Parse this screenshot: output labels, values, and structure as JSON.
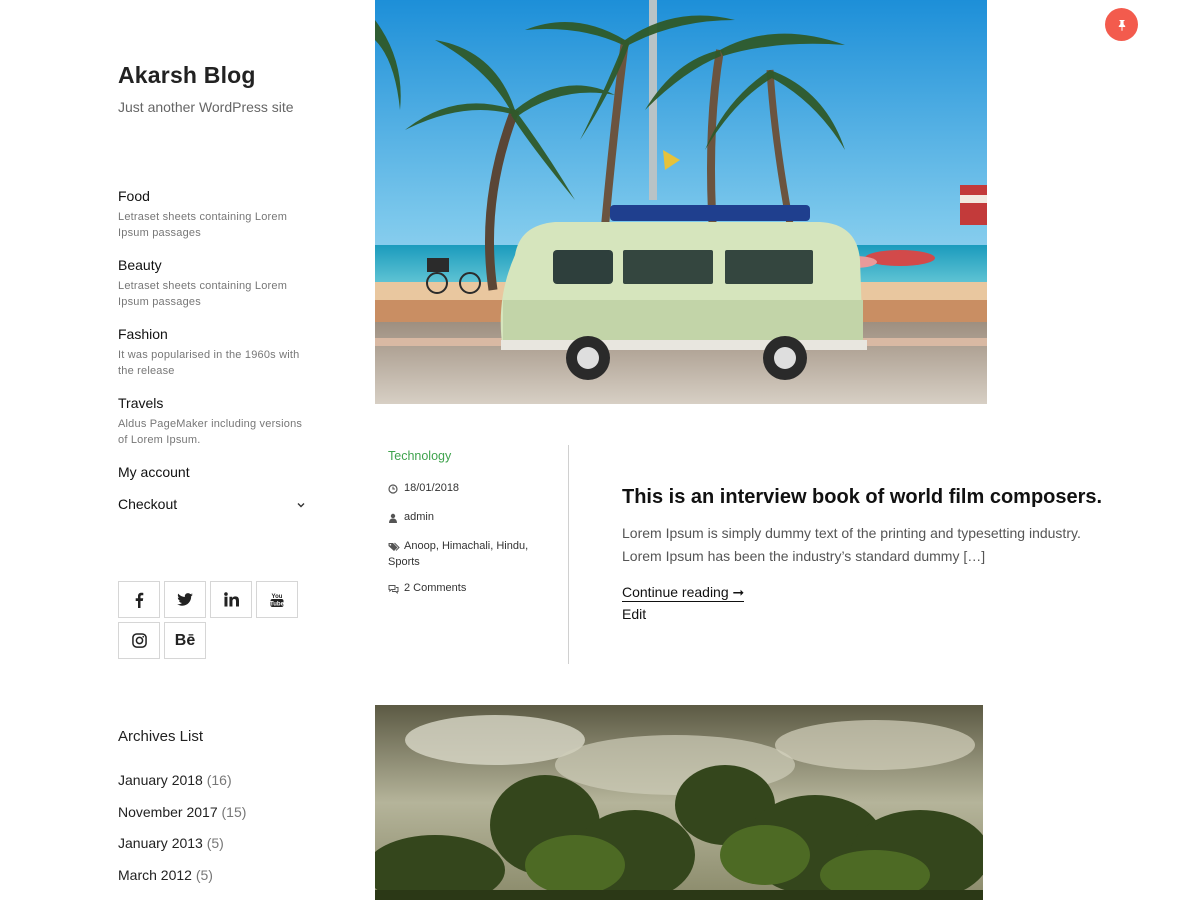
{
  "site": {
    "title": "Akarsh Blog",
    "tagline": "Just another WordPress site"
  },
  "menu": {
    "items": [
      {
        "label": "Food",
        "description": "Letraset sheets containing Lorem Ipsum passages"
      },
      {
        "label": "Beauty",
        "description": "Letraset sheets containing Lorem Ipsum passages"
      },
      {
        "label": "Fashion",
        "description": "It was popularised in the 1960s with the release"
      },
      {
        "label": "Travels",
        "description": "Aldus PageMaker including versions of Lorem Ipsum."
      },
      {
        "label": "My account"
      },
      {
        "label": "Checkout",
        "icon": "chevron-down-icon"
      }
    ]
  },
  "social": {
    "icons": [
      "facebook-icon",
      "twitter-icon",
      "linkedin-icon",
      "youtube-icon",
      "instagram-icon",
      "behance-icon"
    ],
    "behance_text": "Bē"
  },
  "archives": {
    "title": "Archives List",
    "items": [
      {
        "label": "January 2018",
        "count": "(16)"
      },
      {
        "label": "November 2017",
        "count": "(15)"
      },
      {
        "label": "January 2013",
        "count": "(5)"
      },
      {
        "label": "March 2012",
        "count": "(5)"
      }
    ]
  },
  "post": {
    "category": "Technology",
    "date": "18/01/2018",
    "author": "admin",
    "tags": [
      "Anoop",
      "Himachali",
      "Hindu",
      "Sports"
    ],
    "comments": "2 Comments",
    "title": "This is an interview book of world film composers.",
    "excerpt": "Lorem Ipsum is simply dummy text of the printing and typesetting industry. Lorem Ipsum has been the industry’s standard dummy […]",
    "continue_label": "Continue reading",
    "continue_arrow": "➞",
    "edit_label": "Edit"
  },
  "colors": {
    "accent_green": "#3fa34d",
    "pin_red": "#f35b4d"
  }
}
